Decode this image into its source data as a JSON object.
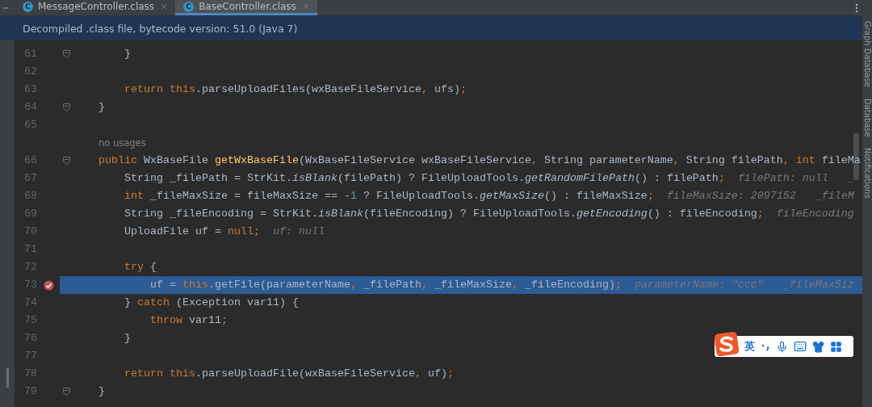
{
  "tabs": [
    {
      "badge": "C",
      "label": "MessageController.class",
      "selected": false
    },
    {
      "badge": "C",
      "label": "BaseController.class",
      "selected": true
    }
  ],
  "banner": "Decompiled .class file, bytecode version: 51.0 (Java 7)",
  "side_tools": [
    "Graph Database",
    "Database",
    "Notifications"
  ],
  "lines": [
    {
      "number": "61",
      "fold": true,
      "breakpoint": false,
      "selected": false,
      "tokens": [
        {
          "kind": "plain",
          "text": "        }"
        }
      ]
    },
    {
      "number": "62",
      "fold": false,
      "breakpoint": false,
      "selected": false
    },
    {
      "number": "63",
      "fold": false,
      "breakpoint": false,
      "selected": false,
      "tokens": [
        {
          "kind": "kw",
          "text": "        return this"
        },
        {
          "kind": "plain",
          "text": ".parseUploadFiles(wxBaseFileService"
        },
        {
          "kind": "sep",
          "text": ", "
        },
        {
          "kind": "plain",
          "text": "ufs)"
        },
        {
          "kind": "sep",
          "text": ";"
        }
      ]
    },
    {
      "number": "64",
      "fold": true,
      "breakpoint": false,
      "selected": false,
      "tokens": [
        {
          "kind": "plain",
          "text": "    }"
        }
      ]
    },
    {
      "number": "65",
      "fold": false,
      "breakpoint": false,
      "selected": false
    },
    {
      "note": "no usages"
    },
    {
      "number": "66",
      "fold": true,
      "breakpoint": false,
      "selected": false,
      "tokens": [
        {
          "kind": "kw",
          "text": "    public "
        },
        {
          "kind": "plain",
          "text": "WxBaseFile "
        },
        {
          "kind": "fn",
          "text": "getWxBaseFile"
        },
        {
          "kind": "plain",
          "text": "(WxBaseFileService wxBaseFileService"
        },
        {
          "kind": "sep",
          "text": ", "
        },
        {
          "kind": "plain",
          "text": "String parameterName"
        },
        {
          "kind": "sep",
          "text": ", "
        },
        {
          "kind": "plain",
          "text": "String filePath"
        },
        {
          "kind": "sep",
          "text": ", "
        },
        {
          "kind": "kw",
          "text": "int "
        },
        {
          "kind": "plain",
          "text": "fileMa"
        }
      ]
    },
    {
      "number": "67",
      "fold": false,
      "breakpoint": false,
      "selected": false,
      "tokens": [
        {
          "kind": "plain",
          "text": "        String _filePath = StrKit."
        },
        {
          "kind": "static",
          "text": "isBlank"
        },
        {
          "kind": "plain",
          "text": "(filePath) ? FileUploadTools."
        },
        {
          "kind": "static",
          "text": "getRandomFilePath"
        },
        {
          "kind": "plain",
          "text": "() : filePath"
        },
        {
          "kind": "sep",
          "text": ";"
        }
      ],
      "hints": [
        "filePath: null",
        "_"
      ]
    },
    {
      "number": "68",
      "fold": false,
      "breakpoint": false,
      "selected": false,
      "tokens": [
        {
          "kind": "kw",
          "text": "        int "
        },
        {
          "kind": "plain",
          "text": "_fileMaxSize = fileMaxSize == -"
        },
        {
          "kind": "num",
          "text": "1"
        },
        {
          "kind": "plain",
          "text": " ? FileUploadTools."
        },
        {
          "kind": "static",
          "text": "getMaxSize"
        },
        {
          "kind": "plain",
          "text": "() : fileMaxSize"
        },
        {
          "kind": "sep",
          "text": ";"
        }
      ],
      "hints": [
        "fileMaxSize: 2097152",
        "_fileM"
      ]
    },
    {
      "number": "69",
      "fold": false,
      "breakpoint": false,
      "selected": false,
      "tokens": [
        {
          "kind": "plain",
          "text": "        String _fileEncoding = StrKit."
        },
        {
          "kind": "static",
          "text": "isBlank"
        },
        {
          "kind": "plain",
          "text": "(fileEncoding) ? FileUploadTools."
        },
        {
          "kind": "static",
          "text": "getEncoding"
        },
        {
          "kind": "plain",
          "text": "() : fileEncoding"
        },
        {
          "kind": "sep",
          "text": ";"
        }
      ],
      "hints": [
        "fileEncoding"
      ]
    },
    {
      "number": "70",
      "fold": false,
      "breakpoint": false,
      "selected": false,
      "tokens": [
        {
          "kind": "plain",
          "text": "        UploadFile uf = "
        },
        {
          "kind": "kw",
          "text": "null"
        },
        {
          "kind": "sep",
          "text": ";"
        }
      ],
      "hints": [
        "uf: null"
      ]
    },
    {
      "number": "71",
      "fold": false,
      "breakpoint": false,
      "selected": false
    },
    {
      "number": "72",
      "fold": false,
      "breakpoint": false,
      "selected": false,
      "tokens": [
        {
          "kind": "kw",
          "text": "        try "
        },
        {
          "kind": "plain",
          "text": "{"
        }
      ]
    },
    {
      "number": "73",
      "fold": false,
      "breakpoint": true,
      "selected": true,
      "tokens": [
        {
          "kind": "plain",
          "text": "            uf = "
        },
        {
          "kind": "kw",
          "text": "this"
        },
        {
          "kind": "plain",
          "text": ".getFile(parameterName"
        },
        {
          "kind": "sep",
          "text": ", "
        },
        {
          "kind": "plain",
          "text": "_filePath"
        },
        {
          "kind": "sep",
          "text": ", "
        },
        {
          "kind": "plain",
          "text": "_fileMaxSize"
        },
        {
          "kind": "sep",
          "text": ", "
        },
        {
          "kind": "plain",
          "text": "_fileEncoding)"
        },
        {
          "kind": "sep",
          "text": ";"
        }
      ],
      "hints": [
        "parameterName: \"ccc\"",
        "_fileMaxSiz"
      ]
    },
    {
      "number": "74",
      "fold": false,
      "breakpoint": false,
      "selected": false,
      "tokens": [
        {
          "kind": "plain",
          "text": "        } "
        },
        {
          "kind": "kw",
          "text": "catch "
        },
        {
          "kind": "plain",
          "text": "(Exception var11) {"
        }
      ]
    },
    {
      "number": "75",
      "fold": false,
      "breakpoint": false,
      "selected": false,
      "tokens": [
        {
          "kind": "kw",
          "text": "            throw "
        },
        {
          "kind": "plain",
          "text": "var11"
        },
        {
          "kind": "sep",
          "text": ";"
        }
      ]
    },
    {
      "number": "76",
      "fold": false,
      "breakpoint": false,
      "selected": false,
      "tokens": [
        {
          "kind": "plain",
          "text": "        }"
        }
      ]
    },
    {
      "number": "77",
      "fold": false,
      "breakpoint": false,
      "selected": false
    },
    {
      "number": "78",
      "fold": false,
      "breakpoint": false,
      "selected": false,
      "tokens": [
        {
          "kind": "kw",
          "text": "        return this"
        },
        {
          "kind": "plain",
          "text": ".parseUploadFile(wxBaseFileService"
        },
        {
          "kind": "sep",
          "text": ", "
        },
        {
          "kind": "plain",
          "text": "uf)"
        },
        {
          "kind": "sep",
          "text": ";"
        }
      ]
    },
    {
      "number": "79",
      "fold": true,
      "breakpoint": false,
      "selected": false,
      "tokens": [
        {
          "kind": "plain",
          "text": "    }"
        }
      ]
    }
  ],
  "ime_bar": {
    "mode": "英"
  }
}
